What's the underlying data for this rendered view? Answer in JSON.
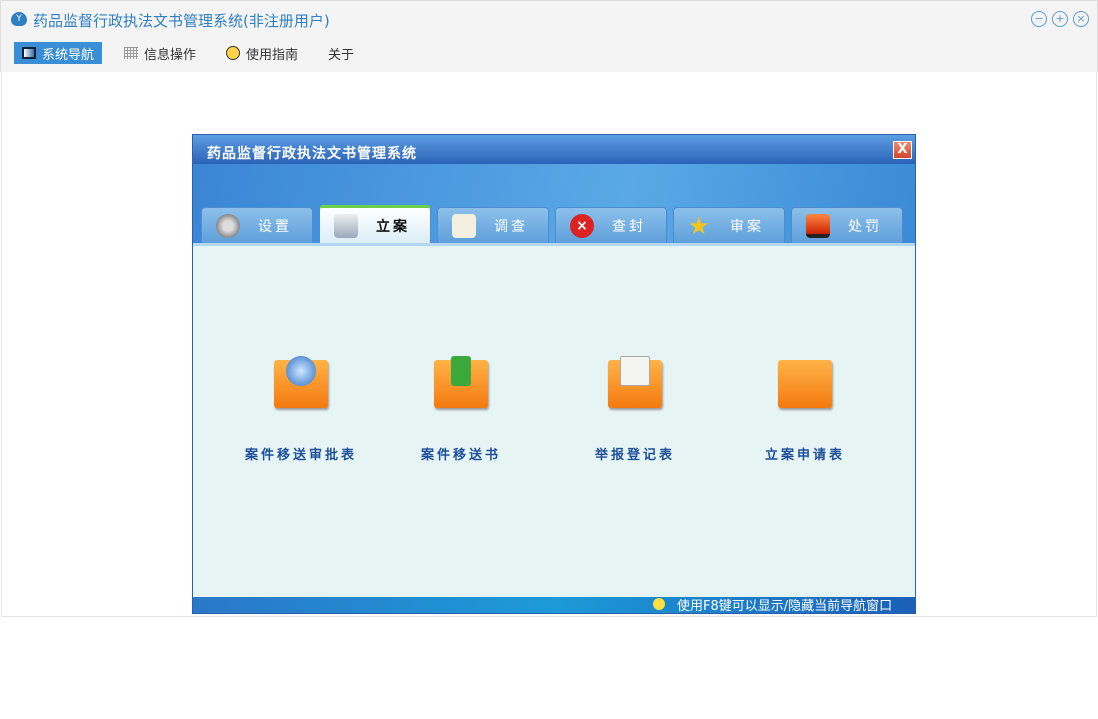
{
  "app": {
    "title": "药品监督行政执法文书管理系统(非注册用户)"
  },
  "menu": [
    {
      "label": "系统导航"
    },
    {
      "label": "信息操作"
    },
    {
      "label": "使用指南"
    },
    {
      "label": "关于"
    }
  ],
  "window": {
    "title": "药品监督行政执法文书管理系统",
    "close": "X",
    "tabs": [
      {
        "label": "设置"
      },
      {
        "label": "立案"
      },
      {
        "label": "调查"
      },
      {
        "label": "查封"
      },
      {
        "label": "审案"
      },
      {
        "label": "处罚"
      }
    ],
    "items": [
      {
        "label": "案件移送审批表"
      },
      {
        "label": "案件移送书"
      },
      {
        "label": "举报登记表"
      },
      {
        "label": "立案申请表"
      }
    ],
    "status": "使用F8键可以显示/隐藏当前导航窗口"
  }
}
